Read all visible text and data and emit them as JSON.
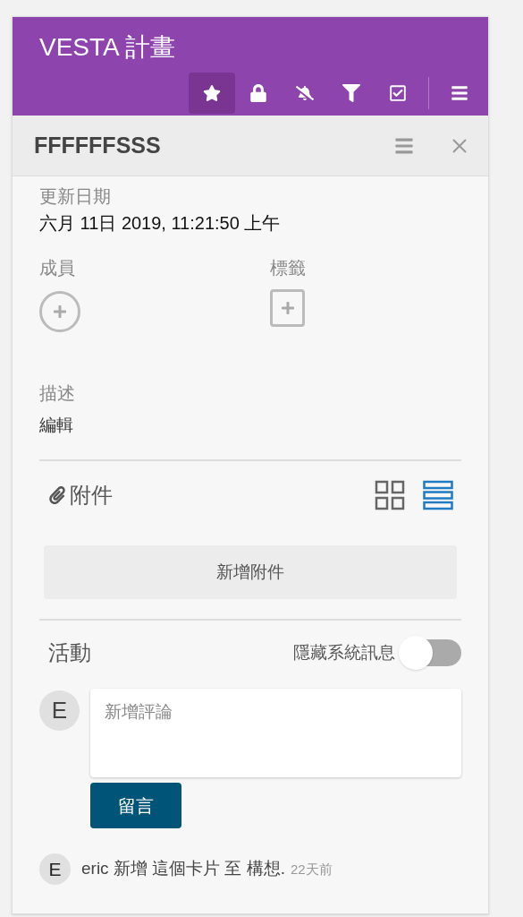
{
  "header": {
    "title": "VESTA 計畫",
    "toolbar": [
      {
        "kind": "star",
        "selected": true
      },
      {
        "kind": "lock",
        "selected": false
      },
      {
        "kind": "bell-off",
        "selected": false
      },
      {
        "kind": "filter",
        "selected": false
      },
      {
        "kind": "checklist",
        "selected": false
      },
      {
        "kind": "menu",
        "selected": false
      }
    ]
  },
  "card": {
    "title": "FFFFFFSSS",
    "updated": {
      "label": "更新日期",
      "value": "六月 11日 2019, 11:21:50 上午"
    },
    "members": {
      "label": "成員"
    },
    "labels": {
      "label": "標籤"
    },
    "description": {
      "label": "描述",
      "edit": "編輯"
    },
    "attachments": {
      "title": "附件",
      "views": [
        {
          "kind": "grid",
          "selected": false
        },
        {
          "kind": "list",
          "selected": true
        }
      ],
      "add_button": "新增附件"
    },
    "activity": {
      "title": "活動",
      "hide_system": {
        "label": "隱藏系統訊息",
        "on": false
      },
      "comment": {
        "avatar": "E",
        "placeholder": "新增評論",
        "submit": "留言"
      },
      "entries": [
        {
          "avatar": "E",
          "text": "eric 新增 這個卡片 至 構想.",
          "time": "22天前"
        }
      ]
    }
  }
}
